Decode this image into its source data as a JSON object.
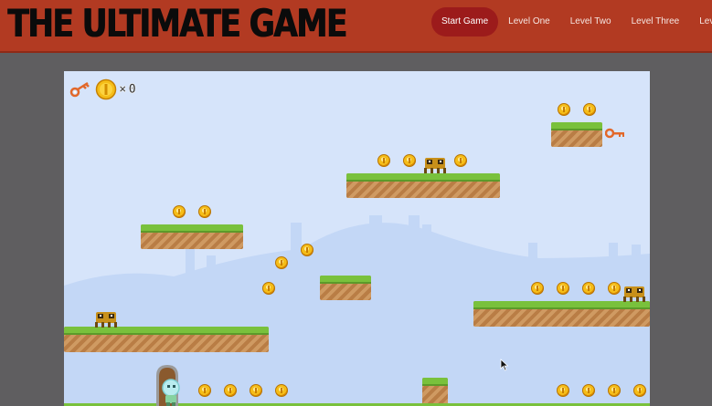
{
  "header": {
    "title": "THE ULTIMATE GAME",
    "nav": [
      {
        "label": "Start Game",
        "active": true
      },
      {
        "label": "Level One",
        "active": false
      },
      {
        "label": "Level Two",
        "active": false
      },
      {
        "label": "Level Three",
        "active": false
      },
      {
        "label": "Level Four",
        "active": false
      }
    ]
  },
  "hud": {
    "key_icon": "key-icon",
    "coin_icon": "coin-icon",
    "coin_count": "0",
    "multiplier": "×"
  },
  "colors": {
    "header": "#b23a22",
    "active_nav": "#9c1b1b",
    "sky": "#d6e4fa",
    "grass": "#79c13c",
    "dirt": "#c79058",
    "coin": "#f5bd18",
    "key": "#e2682a"
  }
}
